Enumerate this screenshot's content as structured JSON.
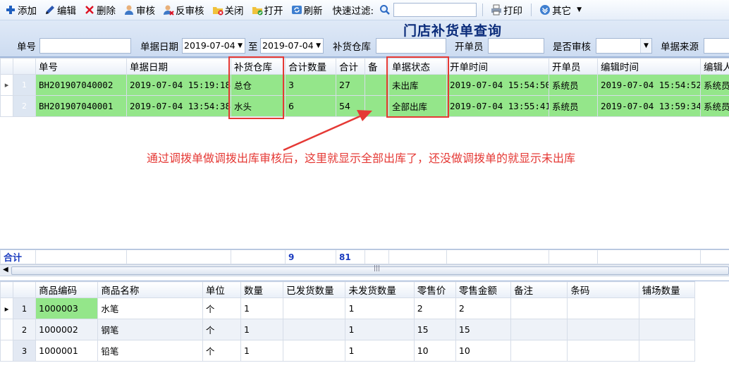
{
  "toolbar": {
    "add": "添加",
    "edit": "编辑",
    "delete": "删除",
    "audit": "审核",
    "unaudit": "反审核",
    "close": "关闭",
    "open": "打开",
    "refresh": "刷新",
    "filter_label": "快速过滤:",
    "print": "打印",
    "other": "其它"
  },
  "page_title": "门店补货单查询",
  "search": {
    "doc_no_label": "单号",
    "date_label": "单据日期",
    "date_from": "2019-07-04",
    "to_label": "至",
    "date_to": "2019-07-04",
    "warehouse_label": "补货仓库",
    "creator_label": "开单员",
    "audited_label": "是否审核",
    "source_label": "单据来源"
  },
  "master": {
    "columns": [
      "单号",
      "单据日期",
      "补货仓库",
      "合计数量",
      "合计",
      "备",
      "单据状态",
      "开单时间",
      "开单员",
      "编辑时间",
      "编辑人"
    ],
    "rows": [
      {
        "rn": "1",
        "no": "BH201907040002",
        "date": "2019-07-04 15:19:18",
        "wh": "总仓",
        "qty": "3",
        "amt": "27",
        "note": "",
        "status": "未出库",
        "created": "2019-07-04 15:54:50",
        "creator": "系统员",
        "edited": "2019-07-04 15:54:52",
        "editor": "系统员"
      },
      {
        "rn": "2",
        "no": "BH201907040001",
        "date": "2019-07-04 13:54:38",
        "wh": "水头",
        "qty": "6",
        "amt": "54",
        "note": "",
        "status": "全部出库",
        "created": "2019-07-04 13:55:41",
        "creator": "系统员",
        "edited": "2019-07-04 13:59:34",
        "editor": "系统员"
      }
    ],
    "sum_label": "合计",
    "sum_qty": "9",
    "sum_amt": "81"
  },
  "annotation": "通过调拨单做调拨出库审核后，这里就显示全部出库了，还没做调拨单的就显示未出库",
  "detail": {
    "columns": [
      "商品编码",
      "商品名称",
      "单位",
      "数量",
      "已发货数量",
      "未发货数量",
      "零售价",
      "零售金额",
      "备注",
      "条码",
      "铺场数量"
    ],
    "rows": [
      {
        "rn": "1",
        "code": "1000003",
        "name": "水笔",
        "unit": "个",
        "qty": "1",
        "shipped": "",
        "unshipped": "1",
        "price": "2",
        "amount": "2"
      },
      {
        "rn": "2",
        "code": "1000002",
        "name": "钢笔",
        "unit": "个",
        "qty": "1",
        "shipped": "",
        "unshipped": "1",
        "price": "15",
        "amount": "15"
      },
      {
        "rn": "3",
        "code": "1000001",
        "name": "铅笔",
        "unit": "个",
        "qty": "1",
        "shipped": "",
        "unshipped": "1",
        "price": "10",
        "amount": "10"
      }
    ]
  },
  "colors": {
    "selected_row": "#94e68a",
    "highlight": "#e53935",
    "title": "#0a2b7a"
  }
}
